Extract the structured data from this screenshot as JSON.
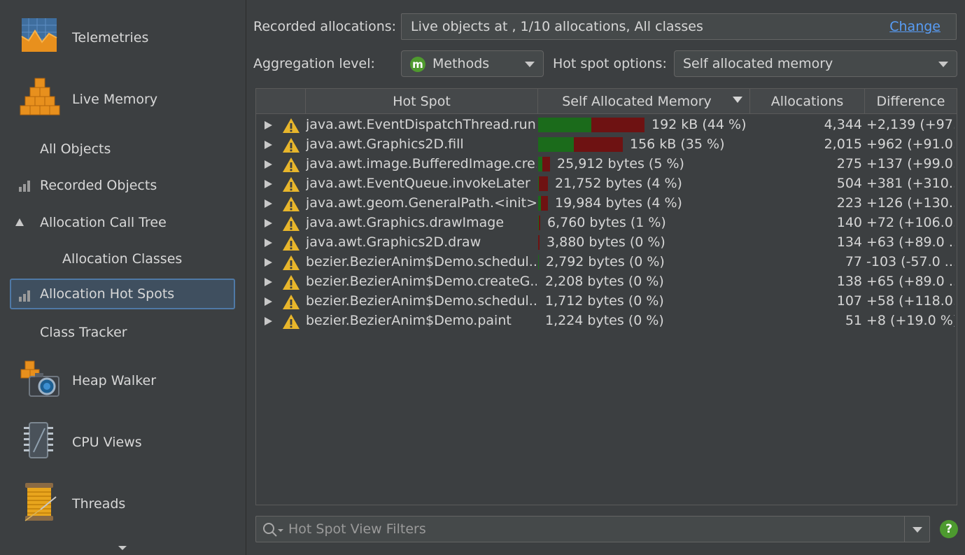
{
  "sidebar": {
    "telemetries": "Telemetries",
    "live_memory": "Live Memory",
    "all_objects": "All Objects",
    "recorded_objects": "Recorded Objects",
    "allocation_call_tree": "Allocation Call Tree",
    "allocation_classes": "Allocation Classes",
    "allocation_hot_spots": "Allocation Hot Spots",
    "class_tracker": "Class Tracker",
    "heap_walker": "Heap Walker",
    "cpu_views": "CPU Views",
    "threads": "Threads"
  },
  "controls": {
    "recorded_label": "Recorded allocations:",
    "recorded_value": "Live objects at  , 1/10 allocations, All classes",
    "change_link": "Change",
    "aggregation_label": "Aggregation level:",
    "aggregation_value": "Methods",
    "aggregation_icon_letter": "m",
    "hotspot_options_label": "Hot spot options:",
    "hotspot_options_value": "Self allocated memory"
  },
  "table": {
    "columns": {
      "hot_spot": "Hot Spot",
      "self_memory": "Self Allocated Memory",
      "allocations": "Allocations",
      "difference": "Difference"
    },
    "rows": [
      {
        "method": "java.awt.EventDispatchThread.run",
        "memory": "192 kB (44 %)",
        "allocations": "4,344",
        "difference": "+2,139 (+97...",
        "percent": 44,
        "green_fraction": 0.5
      },
      {
        "method": "java.awt.Graphics2D.fill",
        "memory": "156 kB (35 %)",
        "allocations": "2,015",
        "difference": "+962 (+91.0...",
        "percent": 35,
        "green_fraction": 0.42
      },
      {
        "method": "java.awt.image.BufferedImage.cre...",
        "memory": "25,912 bytes (5 %)",
        "allocations": "275",
        "difference": "+137 (+99.0...",
        "percent": 5,
        "green_fraction": 0.35
      },
      {
        "method": "java.awt.EventQueue.invokeLater",
        "memory": "21,752 bytes (4 %)",
        "allocations": "504",
        "difference": "+381 (+310....",
        "percent": 4,
        "green_fraction": 0.1
      },
      {
        "method": "java.awt.geom.GeneralPath.<init>",
        "memory": "19,984 bytes (4 %)",
        "allocations": "223",
        "difference": "+126 (+130....",
        "percent": 4,
        "green_fraction": 0.25
      },
      {
        "method": "java.awt.Graphics.drawImage",
        "memory": "6,760 bytes (1 %)",
        "allocations": "140",
        "difference": "+72 (+106.0...",
        "percent": 1,
        "green_fraction": 0.4
      },
      {
        "method": "java.awt.Graphics2D.draw",
        "memory": "3,880 bytes (0 %)",
        "allocations": "134",
        "difference": "+63 (+89.0 ...",
        "percent": 0.5,
        "green_fraction": 0
      },
      {
        "method": "bezier.BezierAnim$Demo.schedul...",
        "memory": "2,792 bytes (0 %)",
        "allocations": "77",
        "difference": "-103 (-57.0 ...",
        "percent": 0.4,
        "green_fraction": 1
      },
      {
        "method": "bezier.BezierAnim$Demo.createG...",
        "memory": "2,208 bytes (0 %)",
        "allocations": "138",
        "difference": "+65 (+89.0 ...",
        "percent": 0,
        "green_fraction": 0
      },
      {
        "method": "bezier.BezierAnim$Demo.schedul...",
        "memory": "1,712 bytes (0 %)",
        "allocations": "107",
        "difference": "+58 (+118.0...",
        "percent": 0,
        "green_fraction": 0
      },
      {
        "method": "bezier.BezierAnim$Demo.paint",
        "memory": "1,224 bytes (0 %)",
        "allocations": "51",
        "difference": "+8 (+19.0 %)",
        "percent": 0,
        "green_fraction": 0
      }
    ]
  },
  "filter": {
    "placeholder": "Hot Spot View Filters"
  },
  "help": "?"
}
